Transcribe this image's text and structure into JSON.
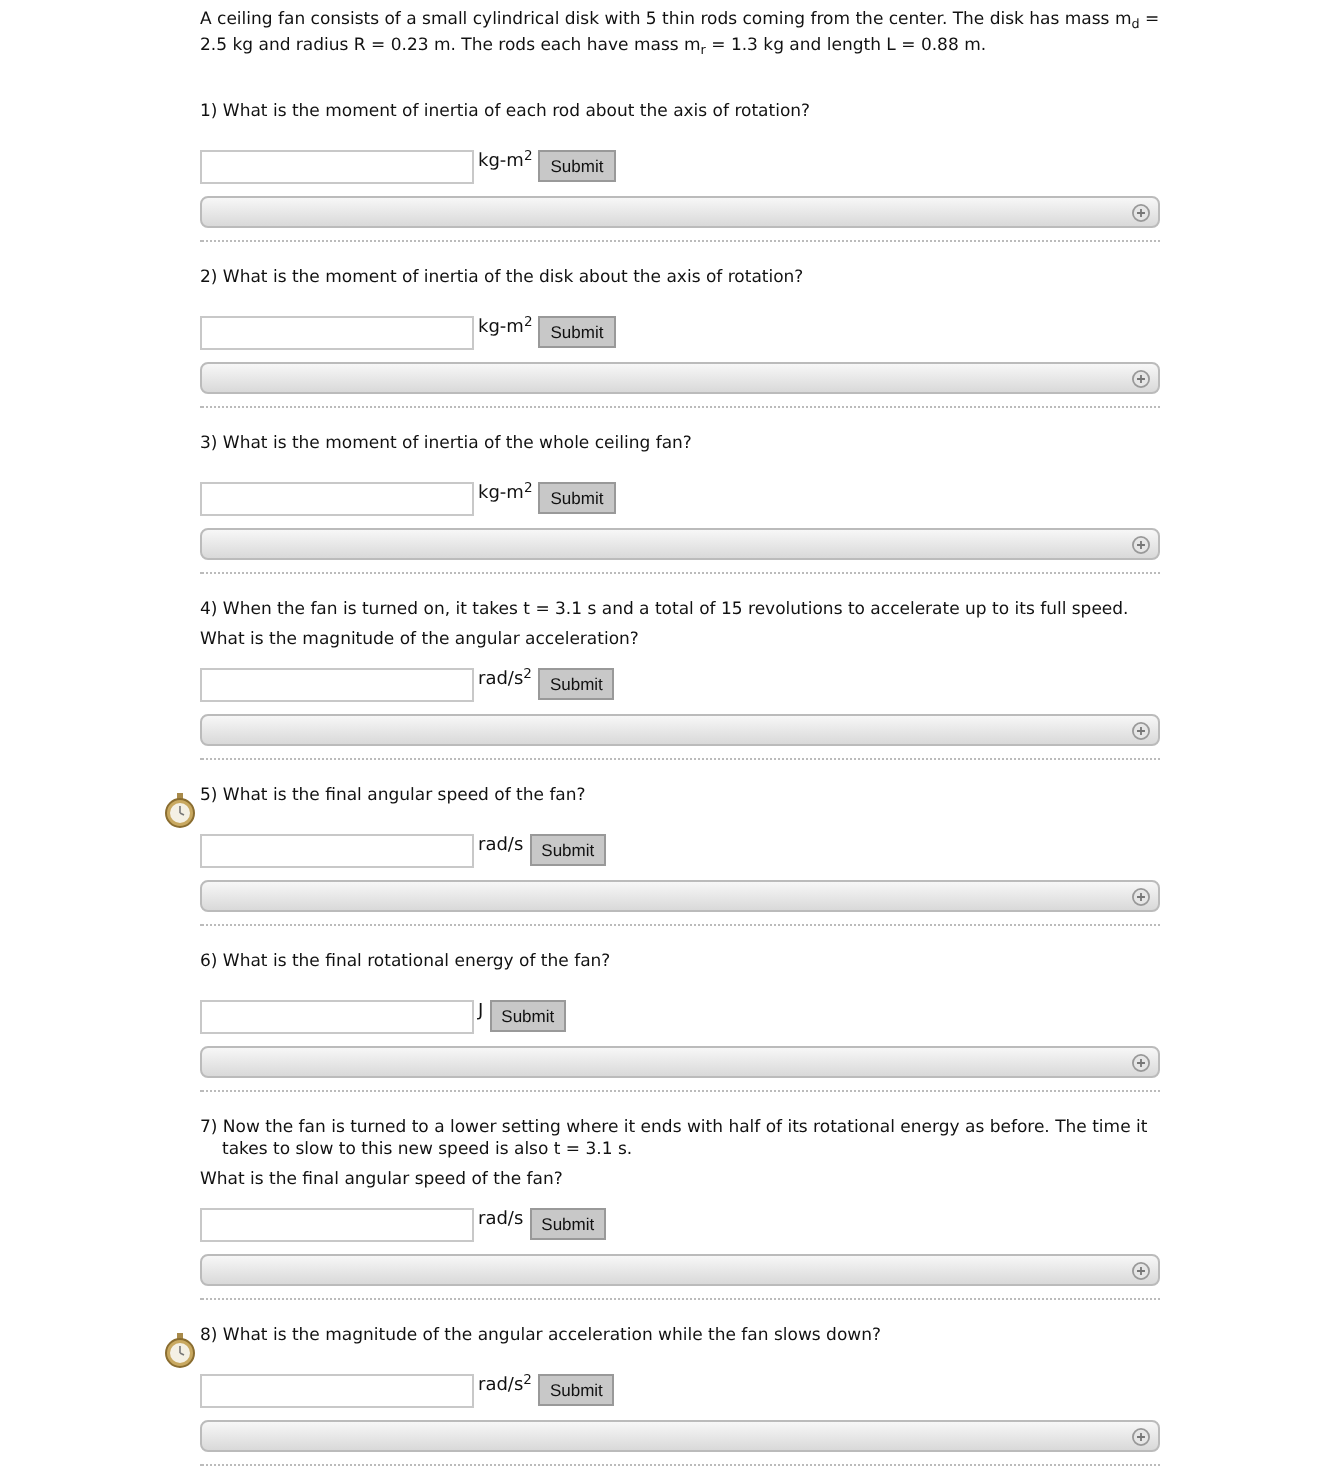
{
  "intro": "A ceiling fan consists of a small cylindrical disk with 5 thin rods coming from the center. The disk has mass m$_{d}$ = 2.5 kg and radius R = 0.23 m. The rods each have mass m$_{r}$ = 1.3 kg and length L = 0.88 m.",
  "questions": [
    {
      "text": "1) What is the moment of inertia of each rod about the axis of rotation?",
      "unit": "kg-m$^{2}$",
      "button": "Submit",
      "timer": false
    },
    {
      "text": "2) What is the moment of inertia of the disk about the axis of rotation?",
      "unit": "kg-m$^{2}$",
      "button": "Submit",
      "timer": false
    },
    {
      "text": "3) What is the moment of inertia of the whole ceiling fan?",
      "unit": "kg-m$^{2}$",
      "button": "Submit",
      "timer": false
    },
    {
      "text": "4) When the fan is turned on, it takes t = 3.1 s and a total of 15 revolutions to accelerate up to its full speed.",
      "followup": "What is the magnitude of the angular acceleration?",
      "unit": "rad/s$^{2}$",
      "button": "Submit",
      "timer": false
    },
    {
      "text": "5) What is the final angular speed of the fan?",
      "unit": "rad/s",
      "button": "Submit",
      "timer": true
    },
    {
      "text": "6) What is the final rotational energy of the fan?",
      "unit": "J",
      "button": "Submit",
      "timer": false
    },
    {
      "text": "7) Now the fan is turned to a lower setting where it ends with half of its rotational energy as before. The time it takes to slow to this new speed is also t = 3.1 s.",
      "followup": "What is the final angular speed of the fan?",
      "unit": "rad/s",
      "button": "Submit",
      "timer": false
    },
    {
      "text": "8) What is the magnitude of the angular acceleration while the fan slows down?",
      "unit": "rad/s$^{2}$",
      "button": "Submit",
      "timer": true
    }
  ]
}
